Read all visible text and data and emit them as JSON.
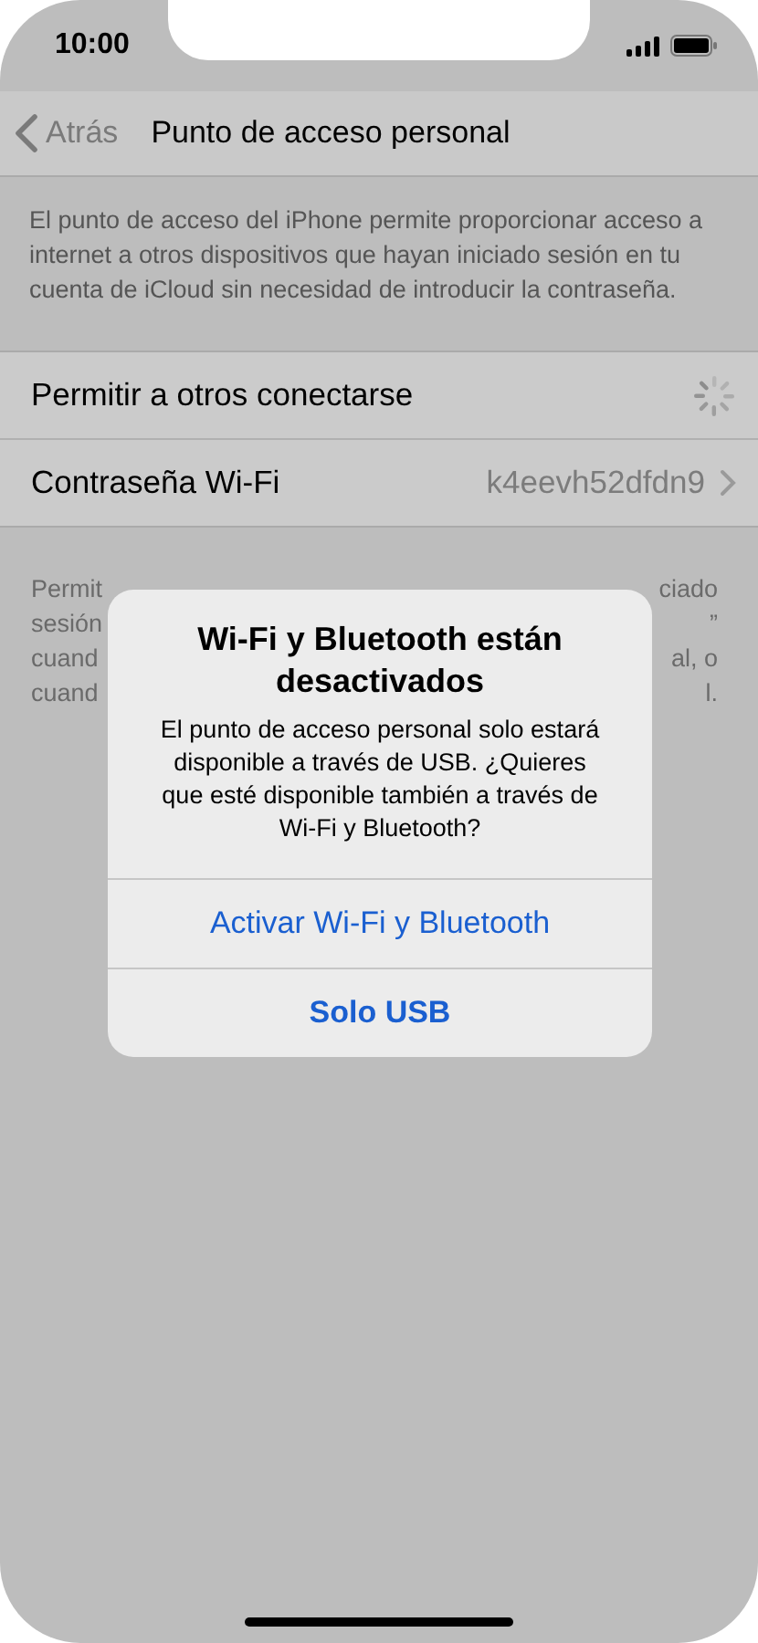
{
  "status_bar": {
    "time": "10:00"
  },
  "nav": {
    "back": "Atrás",
    "title": "Punto de acceso personal"
  },
  "description": "El punto de acceso del iPhone permite proporcionar acceso a internet a otros dispositivos que hayan iniciado sesión en tu cuenta de iCloud sin necesidad de introducir la contraseña.",
  "cells": [
    {
      "kind": "spinner",
      "label": "Permitir a otros conectarse"
    },
    {
      "kind": "disclosure",
      "label": "Contraseña Wi-Fi",
      "value": "k4eevh52dfdn9"
    }
  ],
  "footer_fragments": {
    "left": [
      "Permit",
      "sesión",
      "cuand",
      "cuand"
    ],
    "right": [
      "ciado",
      "”",
      "al, o",
      "l."
    ]
  },
  "alert": {
    "title": "Wi-Fi y Bluetooth están desactivados",
    "message": "El punto de acceso personal solo estará disponible a través de USB. ¿Quieres que esté disponible también a través de Wi-Fi y Bluetooth?",
    "actions": [
      {
        "label": "Activar Wi-Fi y Bluetooth",
        "kind": "default"
      },
      {
        "label": "Solo USB",
        "kind": "preferred"
      }
    ]
  }
}
